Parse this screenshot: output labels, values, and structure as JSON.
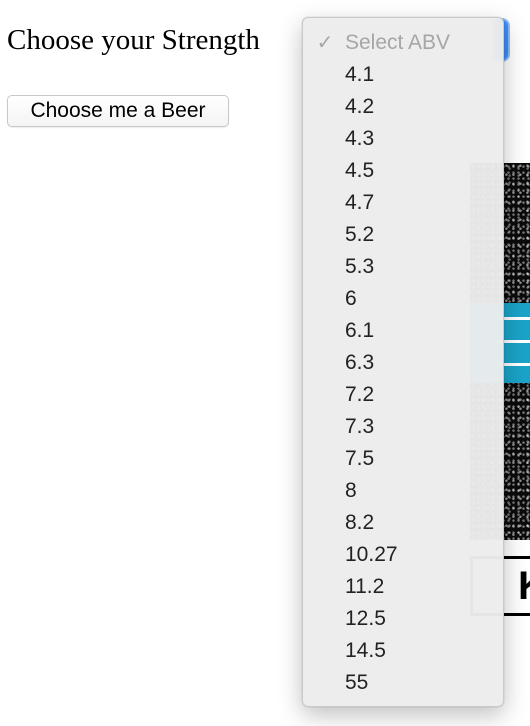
{
  "form": {
    "strength_label": "Choose your Strength",
    "choose_button_label": "Choose me a Beer"
  },
  "abv_select": {
    "placeholder_option": "Select ABV",
    "placeholder_checked_glyph": "✓",
    "options": [
      "4.1",
      "4.2",
      "4.3",
      "4.5",
      "4.7",
      "5.2",
      "5.3",
      "6",
      "6.1",
      "6.3",
      "7.2",
      "7.3",
      "7.5",
      "8",
      "8.2",
      "10.27",
      "11.2",
      "12.5",
      "14.5",
      "55"
    ]
  },
  "background": {
    "banner_fragment_letter": "K"
  },
  "colors": {
    "focus_ring": "#3e8ef7",
    "menu_background": "#ececec",
    "disabled_text": "#a6a6a6",
    "banner_accent": "#1aa3c8"
  }
}
